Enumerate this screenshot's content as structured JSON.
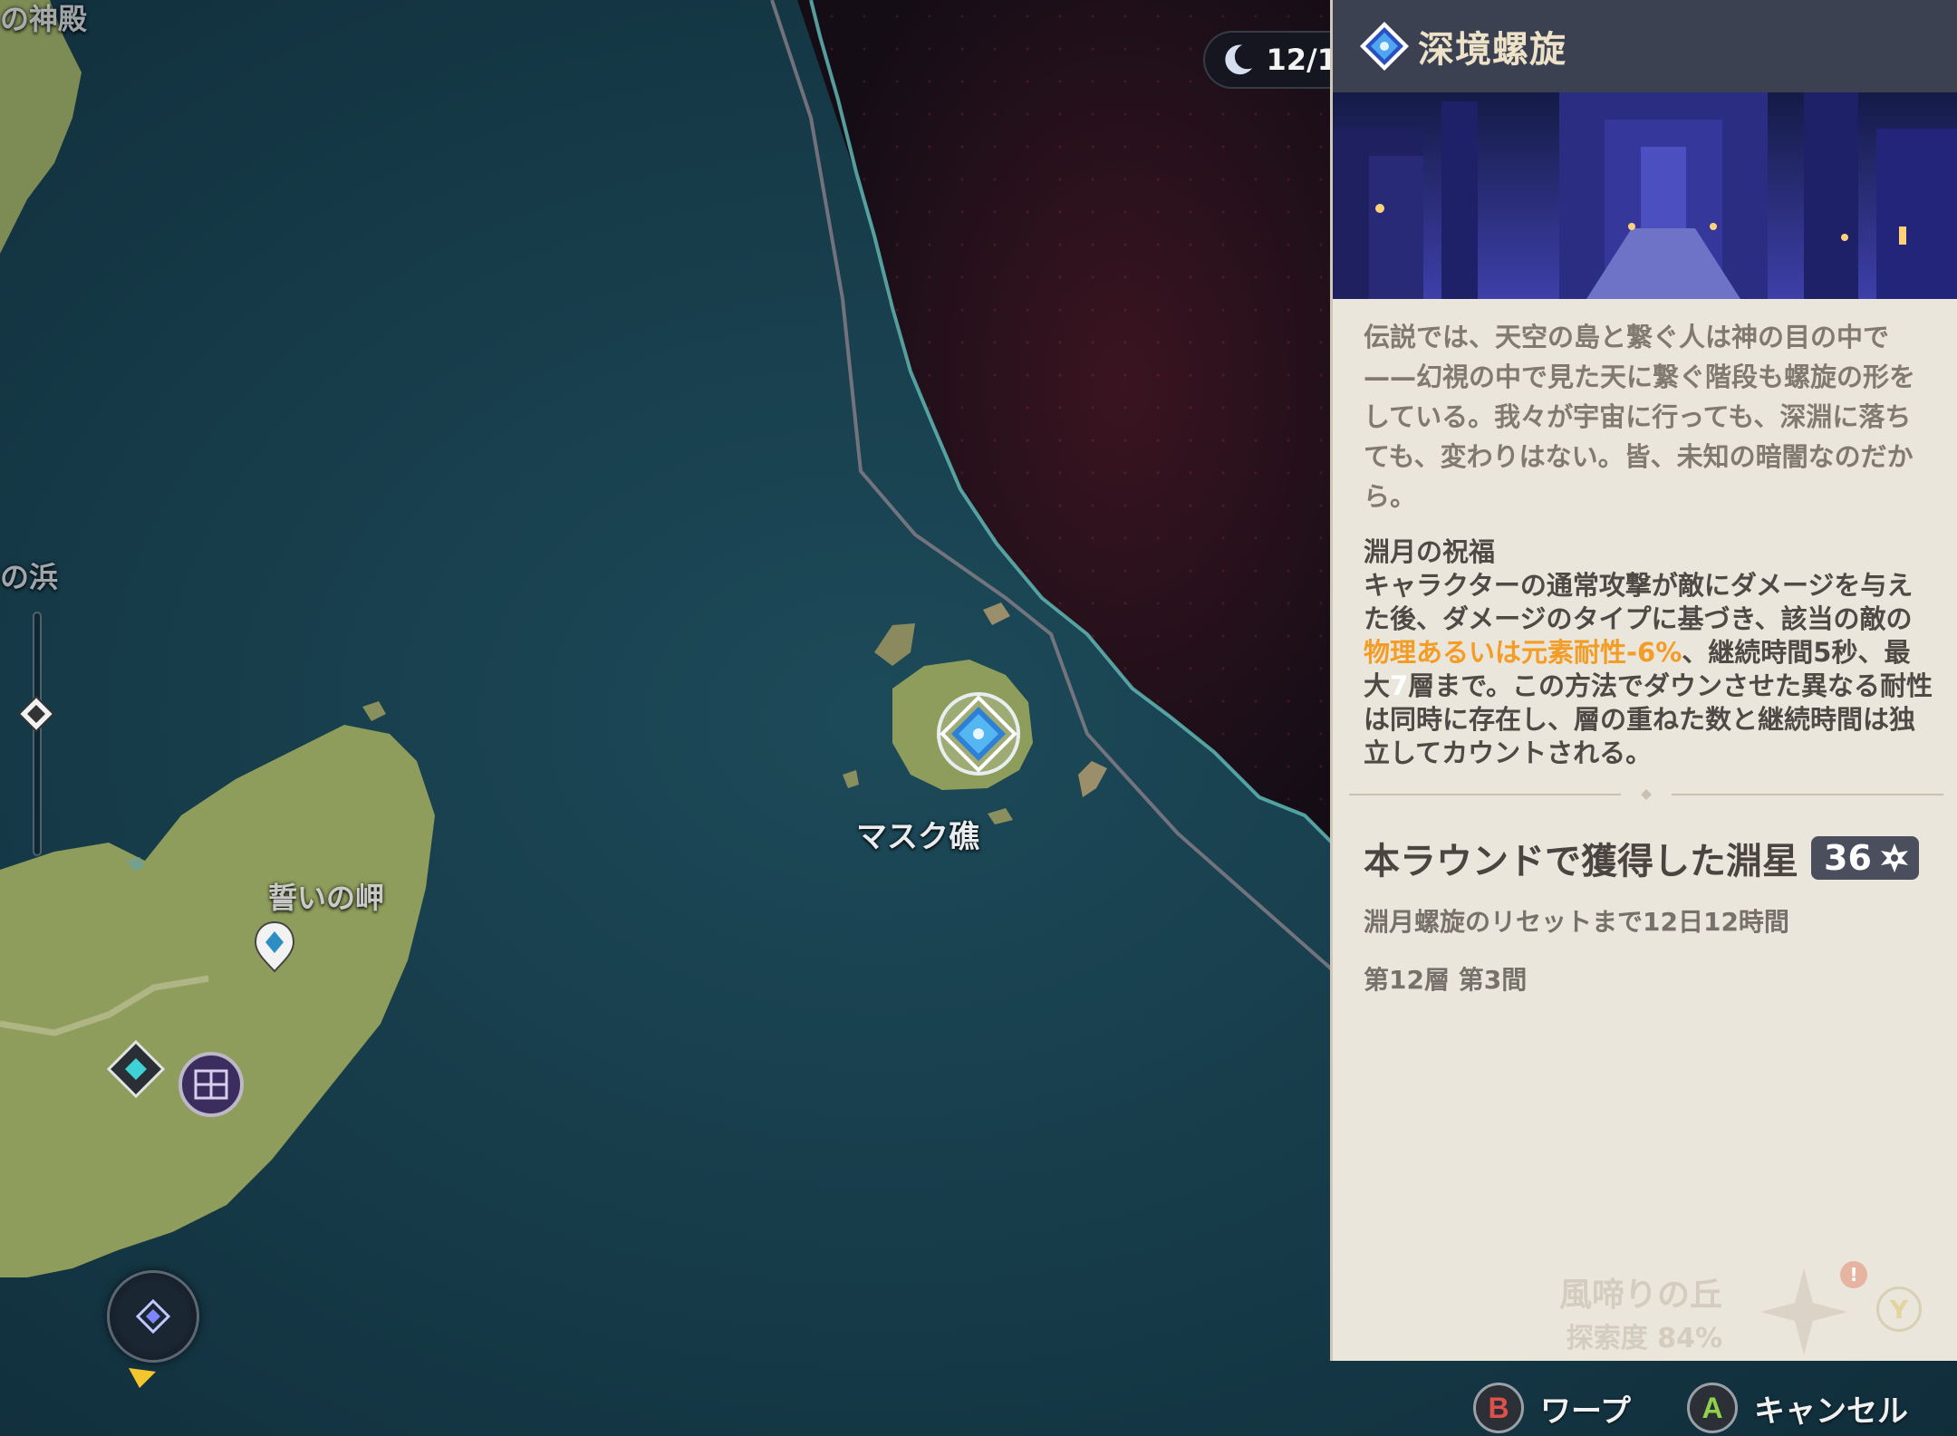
{
  "map": {
    "labels": {
      "top_left_partial": "の神殿",
      "left_partial": "の浜",
      "mask_reef": "マスク礁",
      "oath_cape": "誓いの岬"
    },
    "moon_date": "12/1"
  },
  "panel": {
    "title": "深境螺旋",
    "lore": "伝説では、天空の島と繋ぐ人は神の目の中で——幻視の中で見た天に繋ぐ階段も螺旋の形をしている。我々が宇宙に行っても、深淵に落ちても、変わりはない。皆、未知の暗闇なのだから。",
    "blessing_title": "淵月の祝福",
    "blessing_part1": "キャラクターの通常攻撃が敵にダメージを与えた後、ダメージのタイプに基づき、該当の敵の",
    "blessing_highlight": "物理あるいは元素耐性-6%",
    "blessing_part2": "、継続時間5秒、最大",
    "blessing_highlight2": "7",
    "blessing_part3": "層まで。この方法でダウンさせた異なる耐性は同時に存在し、層の重ねた数と継続時間は独立してカウントされる。",
    "stars_label": "本ラウンドで獲得した淵星",
    "stars_count": "36",
    "reset_text": "淵月螺旋のリセットまで12日12時間",
    "floor_text": "第12層 第3間",
    "region_name": "風啼りの丘",
    "region_progress": "探索度 84%",
    "badge_mark": "!",
    "key_y": "Y"
  },
  "footer": {
    "warp_key": "B",
    "warp_label": "ワープ",
    "cancel_key": "A",
    "cancel_label": "キャンセル"
  },
  "colors": {
    "sea": "#173f4e",
    "abyss": "#2a1018",
    "land": "#8f9d5c",
    "panel_bg": "#ebe6db",
    "panel_header": "#3b4150",
    "highlight": "#f39c26",
    "key_b": "#e0504a",
    "key_a": "#8fd14a"
  },
  "icons": [
    "spiral-abyss-icon",
    "teleport-waypoint-icon",
    "domain-icon",
    "statue-icon",
    "moon-icon",
    "abyss-star-icon",
    "compass-nav-icon"
  ]
}
